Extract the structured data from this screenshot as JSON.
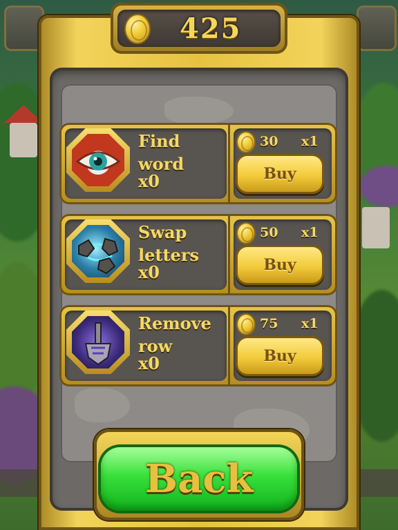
{
  "header": {
    "coins": "425"
  },
  "items": [
    {
      "name_line1": "Find",
      "name_line2": "word",
      "count": "x0",
      "price": "30",
      "multiplier": "x1",
      "buy_label": "Buy",
      "icon": "eye-icon"
    },
    {
      "name_line1": "Swap",
      "name_line2": "letters",
      "count": "x0",
      "price": "50",
      "multiplier": "x1",
      "buy_label": "Buy",
      "icon": "swap-sphere-icon"
    },
    {
      "name_line1": "Remove",
      "name_line2": "row",
      "count": "x0",
      "price": "75",
      "multiplier": "x1",
      "buy_label": "Buy",
      "icon": "hammer-icon"
    }
  ],
  "footer": {
    "back_label": "Back"
  },
  "colors": {
    "gold": "#e6c240",
    "text_gold": "#f5d863",
    "panel": "#8d8a87",
    "green": "#38e03a"
  }
}
